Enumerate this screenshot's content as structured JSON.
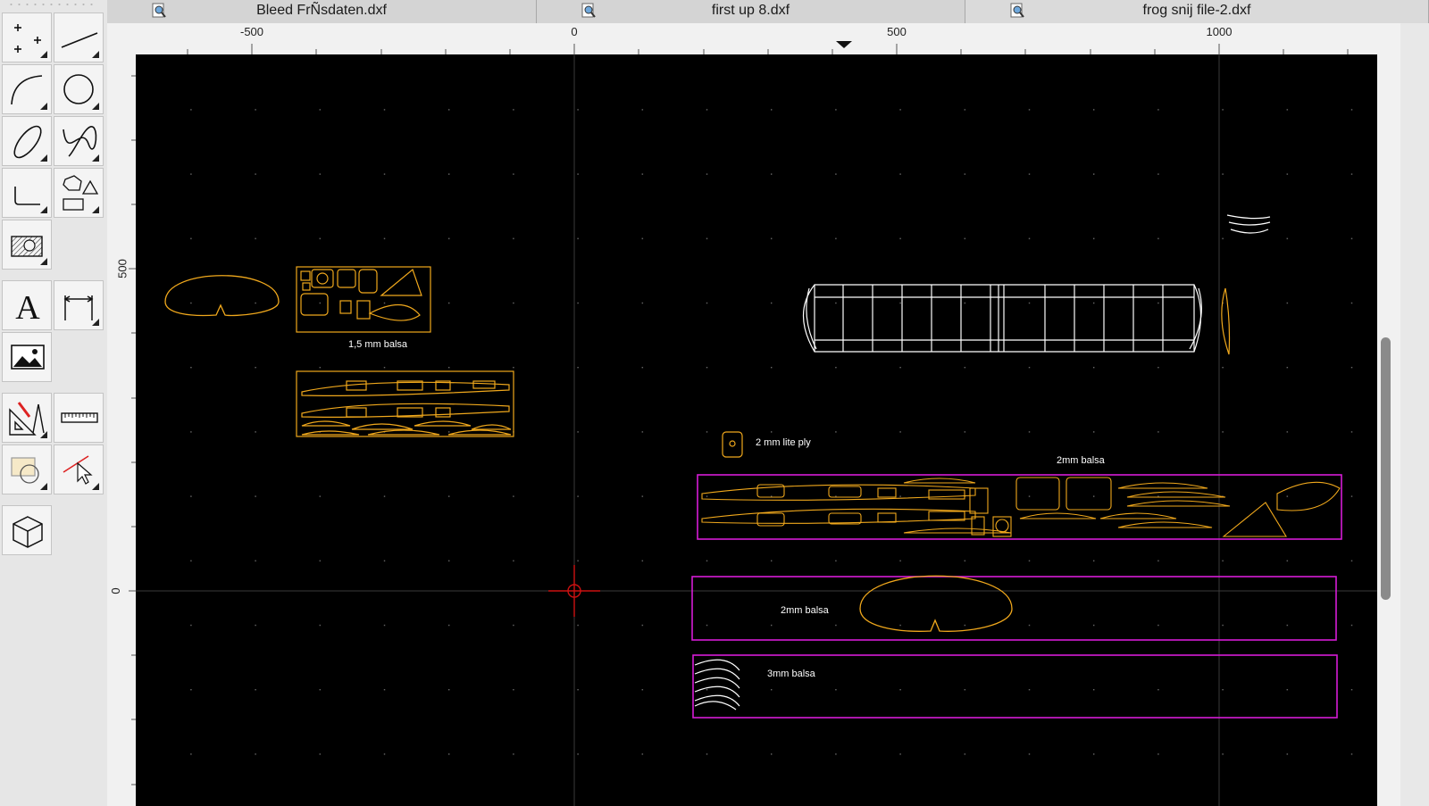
{
  "tabs": [
    {
      "label": "Bleed FrÑsdaten.dxf",
      "icon": "document-magnifier-icon"
    },
    {
      "label": "first up 8.dxf",
      "icon": "document-magnifier-icon"
    },
    {
      "label": "frog snij file-2.dxf",
      "icon": "document-magnifier-icon"
    }
  ],
  "ruler": {
    "horizontal_labels": [
      "-500",
      "0",
      "500",
      "1000"
    ],
    "vertical_labels": [
      "500",
      "0"
    ]
  },
  "toolbox": {
    "tools": [
      "points-tool-icon",
      "line-tool-icon",
      "arc-tool-icon",
      "circle-tool-icon",
      "ellipse-tool-icon",
      "spline-tool-icon",
      "polyline-tool-icon",
      "shapes-tool-icon",
      "hatch-tool-icon",
      "text-tool-icon",
      "dimension-tool-icon",
      "image-tool-icon",
      "construction-tool-icon",
      "measure-tool-icon",
      "modify-tool-icon",
      "select-trim-tool-icon",
      "3d-block-tool-icon"
    ],
    "text_tool_glyph": "A"
  },
  "canvas": {
    "labels": {
      "balsa_small": "1,5 mm balsa",
      "ply": "2 mm lite ply",
      "balsa_2mm_top": "2mm  balsa",
      "balsa_2mm_mid": "2mm  balsa",
      "balsa_3mm": "3mm  balsa"
    },
    "colors": {
      "background": "#000000",
      "parts": "#f0a81c",
      "frames": "#d61cd6",
      "wireframe": "#ffffff",
      "origin": "#cc1111",
      "grid_dot": "#6a6a6a"
    }
  }
}
